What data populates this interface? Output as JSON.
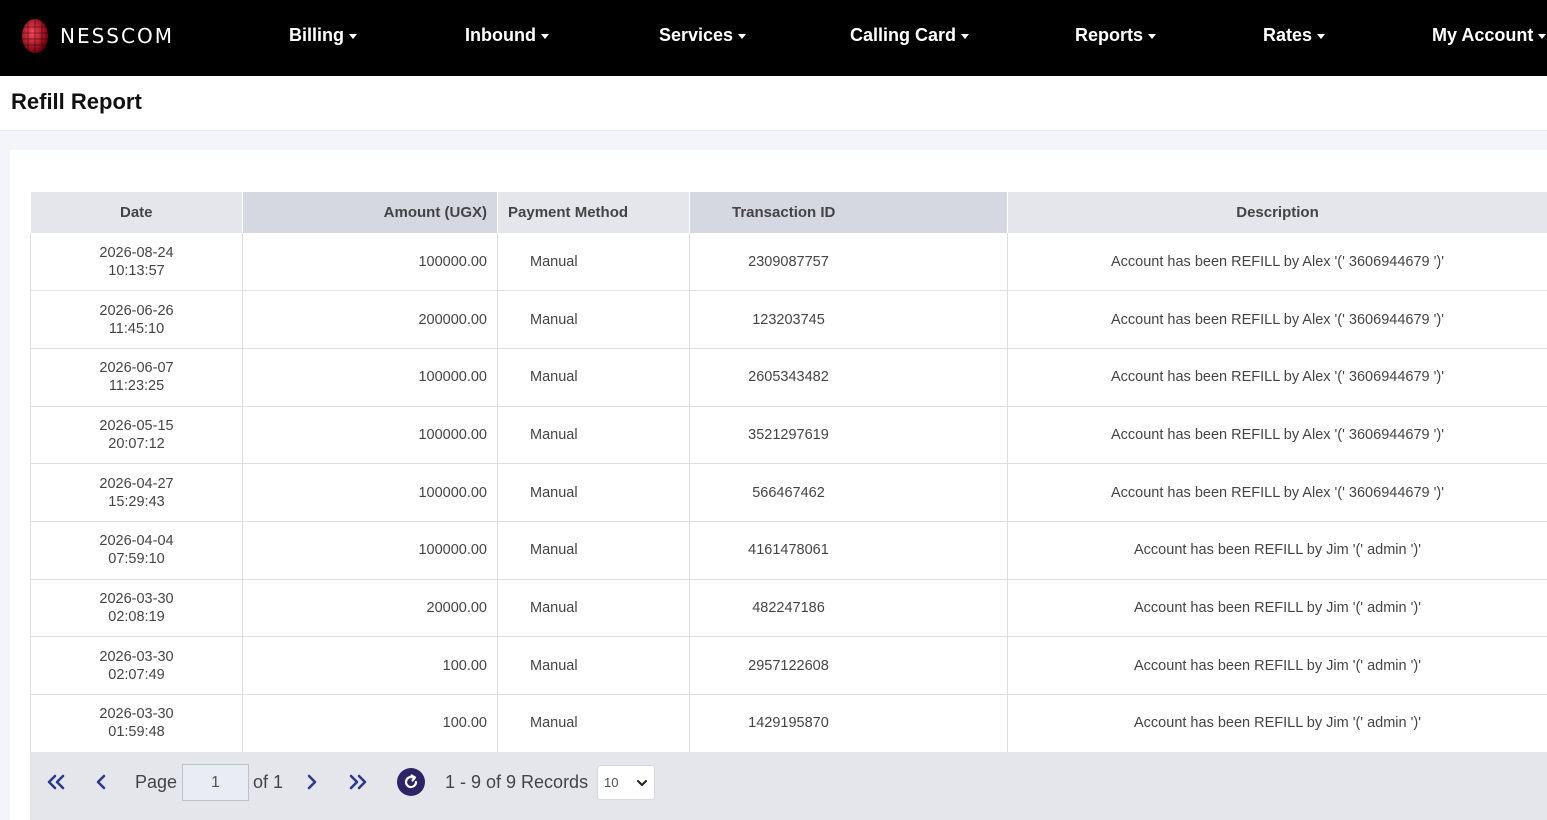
{
  "brand": {
    "name": "NESSCOM"
  },
  "nav": [
    {
      "label": "Billing"
    },
    {
      "label": "Inbound"
    },
    {
      "label": "Services"
    },
    {
      "label": "Calling Card"
    },
    {
      "label": "Reports"
    },
    {
      "label": "Rates"
    },
    {
      "label": "My Account"
    }
  ],
  "page": {
    "title": "Refill Report"
  },
  "table": {
    "headers": {
      "date": "Date",
      "amount": "Amount (UGX)",
      "method": "Payment Method",
      "transaction": "Transaction ID",
      "description": "Description"
    },
    "rows": [
      {
        "date": "2026-08-24",
        "time": "10:13:57",
        "amount": "100000.00",
        "method": "Manual",
        "tx": "2309087757",
        "desc": "Account has been REFILL by Alex '(' 3606944679 ')'"
      },
      {
        "date": "2026-06-26",
        "time": "11:45:10",
        "amount": "200000.00",
        "method": "Manual",
        "tx": "123203745",
        "desc": "Account has been REFILL by Alex '(' 3606944679 ')'"
      },
      {
        "date": "2026-06-07",
        "time": "11:23:25",
        "amount": "100000.00",
        "method": "Manual",
        "tx": "2605343482",
        "desc": "Account has been REFILL by Alex '(' 3606944679 ')'"
      },
      {
        "date": "2026-05-15",
        "time": "20:07:12",
        "amount": "100000.00",
        "method": "Manual",
        "tx": "3521297619",
        "desc": "Account has been REFILL by Alex '(' 3606944679 ')'"
      },
      {
        "date": "2026-04-27",
        "time": "15:29:43",
        "amount": "100000.00",
        "method": "Manual",
        "tx": "566467462",
        "desc": "Account has been REFILL by Alex '(' 3606944679 ')'"
      },
      {
        "date": "2026-04-04",
        "time": "07:59:10",
        "amount": "100000.00",
        "method": "Manual",
        "tx": "4161478061",
        "desc": "Account has been REFILL by Jim '(' admin ')'"
      },
      {
        "date": "2026-03-30",
        "time": "02:08:19",
        "amount": "20000.00",
        "method": "Manual",
        "tx": "482247186",
        "desc": "Account has been REFILL by Jim '(' admin ')'"
      },
      {
        "date": "2026-03-30",
        "time": "02:07:49",
        "amount": "100.00",
        "method": "Manual",
        "tx": "2957122608",
        "desc": "Account has been REFILL by Jim '(' admin ')'"
      },
      {
        "date": "2026-03-30",
        "time": "01:59:48",
        "amount": "100.00",
        "method": "Manual",
        "tx": "1429195870",
        "desc": "Account has been REFILL by Jim '(' admin ')'"
      }
    ]
  },
  "pager": {
    "page_label": "Page",
    "page_value": "1",
    "of_label": "of 1",
    "records_text": "1 - 9 of 9 Records",
    "page_size": "10",
    "icons": {
      "first": "double-chevron-left-icon",
      "prev": "chevron-left-icon",
      "next": "chevron-right-icon",
      "last": "double-chevron-right-icon",
      "refresh": "refresh-icon"
    }
  },
  "colors": {
    "navbar": "#000000",
    "header_bg": "#e4e6ec",
    "refresh_button": "#2b2566"
  }
}
